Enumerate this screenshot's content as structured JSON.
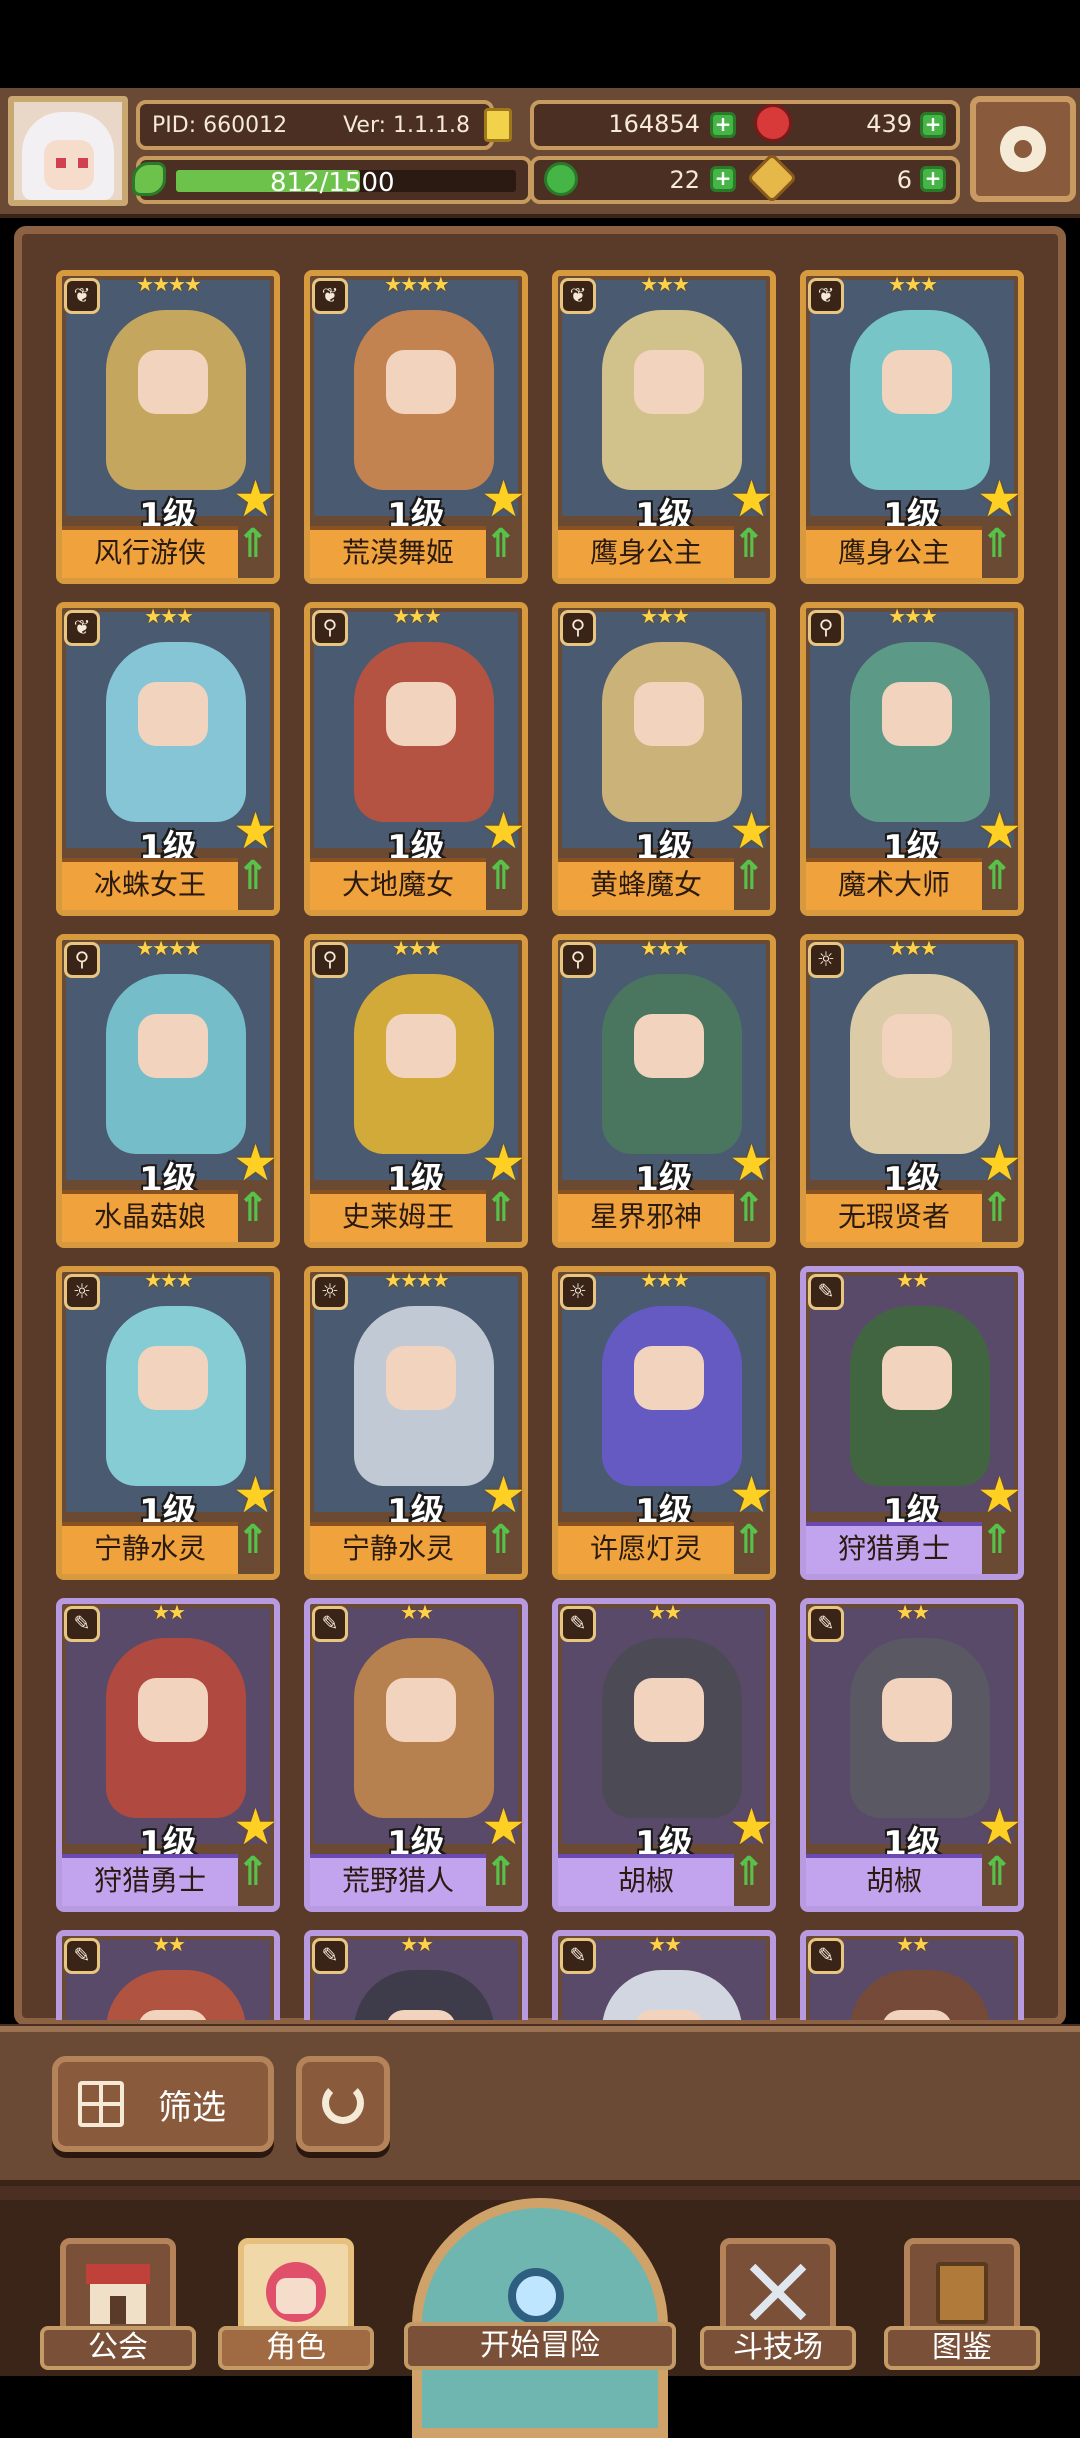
{
  "player": {
    "pid": "PID: 660012",
    "version": "Ver: 1.1.1.8",
    "exp": "812/1500",
    "exp_fraction": 0.54
  },
  "currencies": {
    "gold": "164854",
    "gems": "439",
    "clover": "22",
    "keys": "6"
  },
  "cards": [
    {
      "name": "风行游侠",
      "level": "1级",
      "stars": "★★★★",
      "rarity": "gold",
      "element": "leaf-icon",
      "color": "#d9b45a"
    },
    {
      "name": "荒漠舞姬",
      "level": "1级",
      "stars": "★★★★",
      "rarity": "gold",
      "element": "leaf-icon",
      "color": "#d88b4a"
    },
    {
      "name": "鹰身公主",
      "level": "1级",
      "stars": "★★★",
      "rarity": "gold",
      "element": "leaf-icon",
      "color": "#e9d38e"
    },
    {
      "name": "鹰身公主",
      "level": "1级",
      "stars": "★★★",
      "rarity": "gold",
      "element": "leaf-icon",
      "color": "#7fd8d6"
    },
    {
      "name": "冰蛛女王",
      "level": "1级",
      "stars": "★★★",
      "rarity": "gold",
      "element": "leaf-icon",
      "color": "#8fd8e6"
    },
    {
      "name": "大地魔女",
      "level": "1级",
      "stars": "★★★",
      "rarity": "gold",
      "element": "wrench-icon",
      "color": "#c8523a"
    },
    {
      "name": "黄蜂魔女",
      "level": "1级",
      "stars": "★★★",
      "rarity": "gold",
      "element": "wrench-icon",
      "color": "#e0c27a"
    },
    {
      "name": "魔术大师",
      "level": "1级",
      "stars": "★★★",
      "rarity": "gold",
      "element": "wrench-icon",
      "color": "#5fa58a"
    },
    {
      "name": "水晶菇娘",
      "level": "1级",
      "stars": "★★★★",
      "rarity": "gold",
      "element": "wrench-icon",
      "color": "#7ccfd8"
    },
    {
      "name": "史莱姆王",
      "level": "1级",
      "stars": "★★★",
      "rarity": "gold",
      "element": "wrench-icon",
      "color": "#e9b830"
    },
    {
      "name": "星界邪神",
      "level": "1级",
      "stars": "★★★",
      "rarity": "gold",
      "element": "wrench-icon",
      "color": "#4a7a5a"
    },
    {
      "name": "无瑕贤者",
      "level": "1级",
      "stars": "★★★",
      "rarity": "gold",
      "element": "sun-icon",
      "color": "#f4e0b0"
    },
    {
      "name": "宁静水灵",
      "level": "1级",
      "stars": "★★★",
      "rarity": "gold",
      "element": "sun-icon",
      "color": "#8fe0e6"
    },
    {
      "name": "宁静水灵",
      "level": "1级",
      "stars": "★★★★",
      "rarity": "gold",
      "element": "sun-icon",
      "color": "#d6dde6"
    },
    {
      "name": "许愿灯灵",
      "level": "1级",
      "stars": "★★★",
      "rarity": "gold",
      "element": "sun-icon",
      "color": "#6a5ad0"
    },
    {
      "name": "狩猎勇士",
      "level": "1级",
      "stars": "★★",
      "rarity": "purple",
      "element": "feather-icon",
      "color": "#3e6a3a"
    },
    {
      "name": "狩猎勇士",
      "level": "1级",
      "stars": "★★",
      "rarity": "purple",
      "element": "feather-icon",
      "color": "#c04a38"
    },
    {
      "name": "荒野猎人",
      "level": "1级",
      "stars": "★★",
      "rarity": "purple",
      "element": "feather-icon",
      "color": "#c88a4a"
    },
    {
      "name": "胡椒",
      "level": "1级",
      "stars": "★★",
      "rarity": "purple",
      "element": "feather-icon",
      "color": "#4a4a50"
    },
    {
      "name": "胡椒",
      "level": "1级",
      "stars": "★★",
      "rarity": "purple",
      "element": "feather-icon",
      "color": "#5a5a60"
    },
    {
      "name": "",
      "level": "",
      "stars": "★★",
      "rarity": "purple",
      "element": "feather-icon",
      "color": "#c0553a"
    },
    {
      "name": "",
      "level": "",
      "stars": "★★",
      "rarity": "purple",
      "element": "feather-icon",
      "color": "#3a3a44"
    },
    {
      "name": "",
      "level": "",
      "stars": "★★",
      "rarity": "purple",
      "element": "feather-icon",
      "color": "#e8eef4"
    },
    {
      "name": "",
      "level": "",
      "stars": "★★",
      "rarity": "purple",
      "element": "feather-icon",
      "color": "#7a4a30"
    }
  ],
  "filter": {
    "label": "筛选"
  },
  "nav": {
    "guild": "公会",
    "character": "角色",
    "adventure": "开始冒险",
    "arena": "斗技场",
    "codex": "图鉴"
  }
}
